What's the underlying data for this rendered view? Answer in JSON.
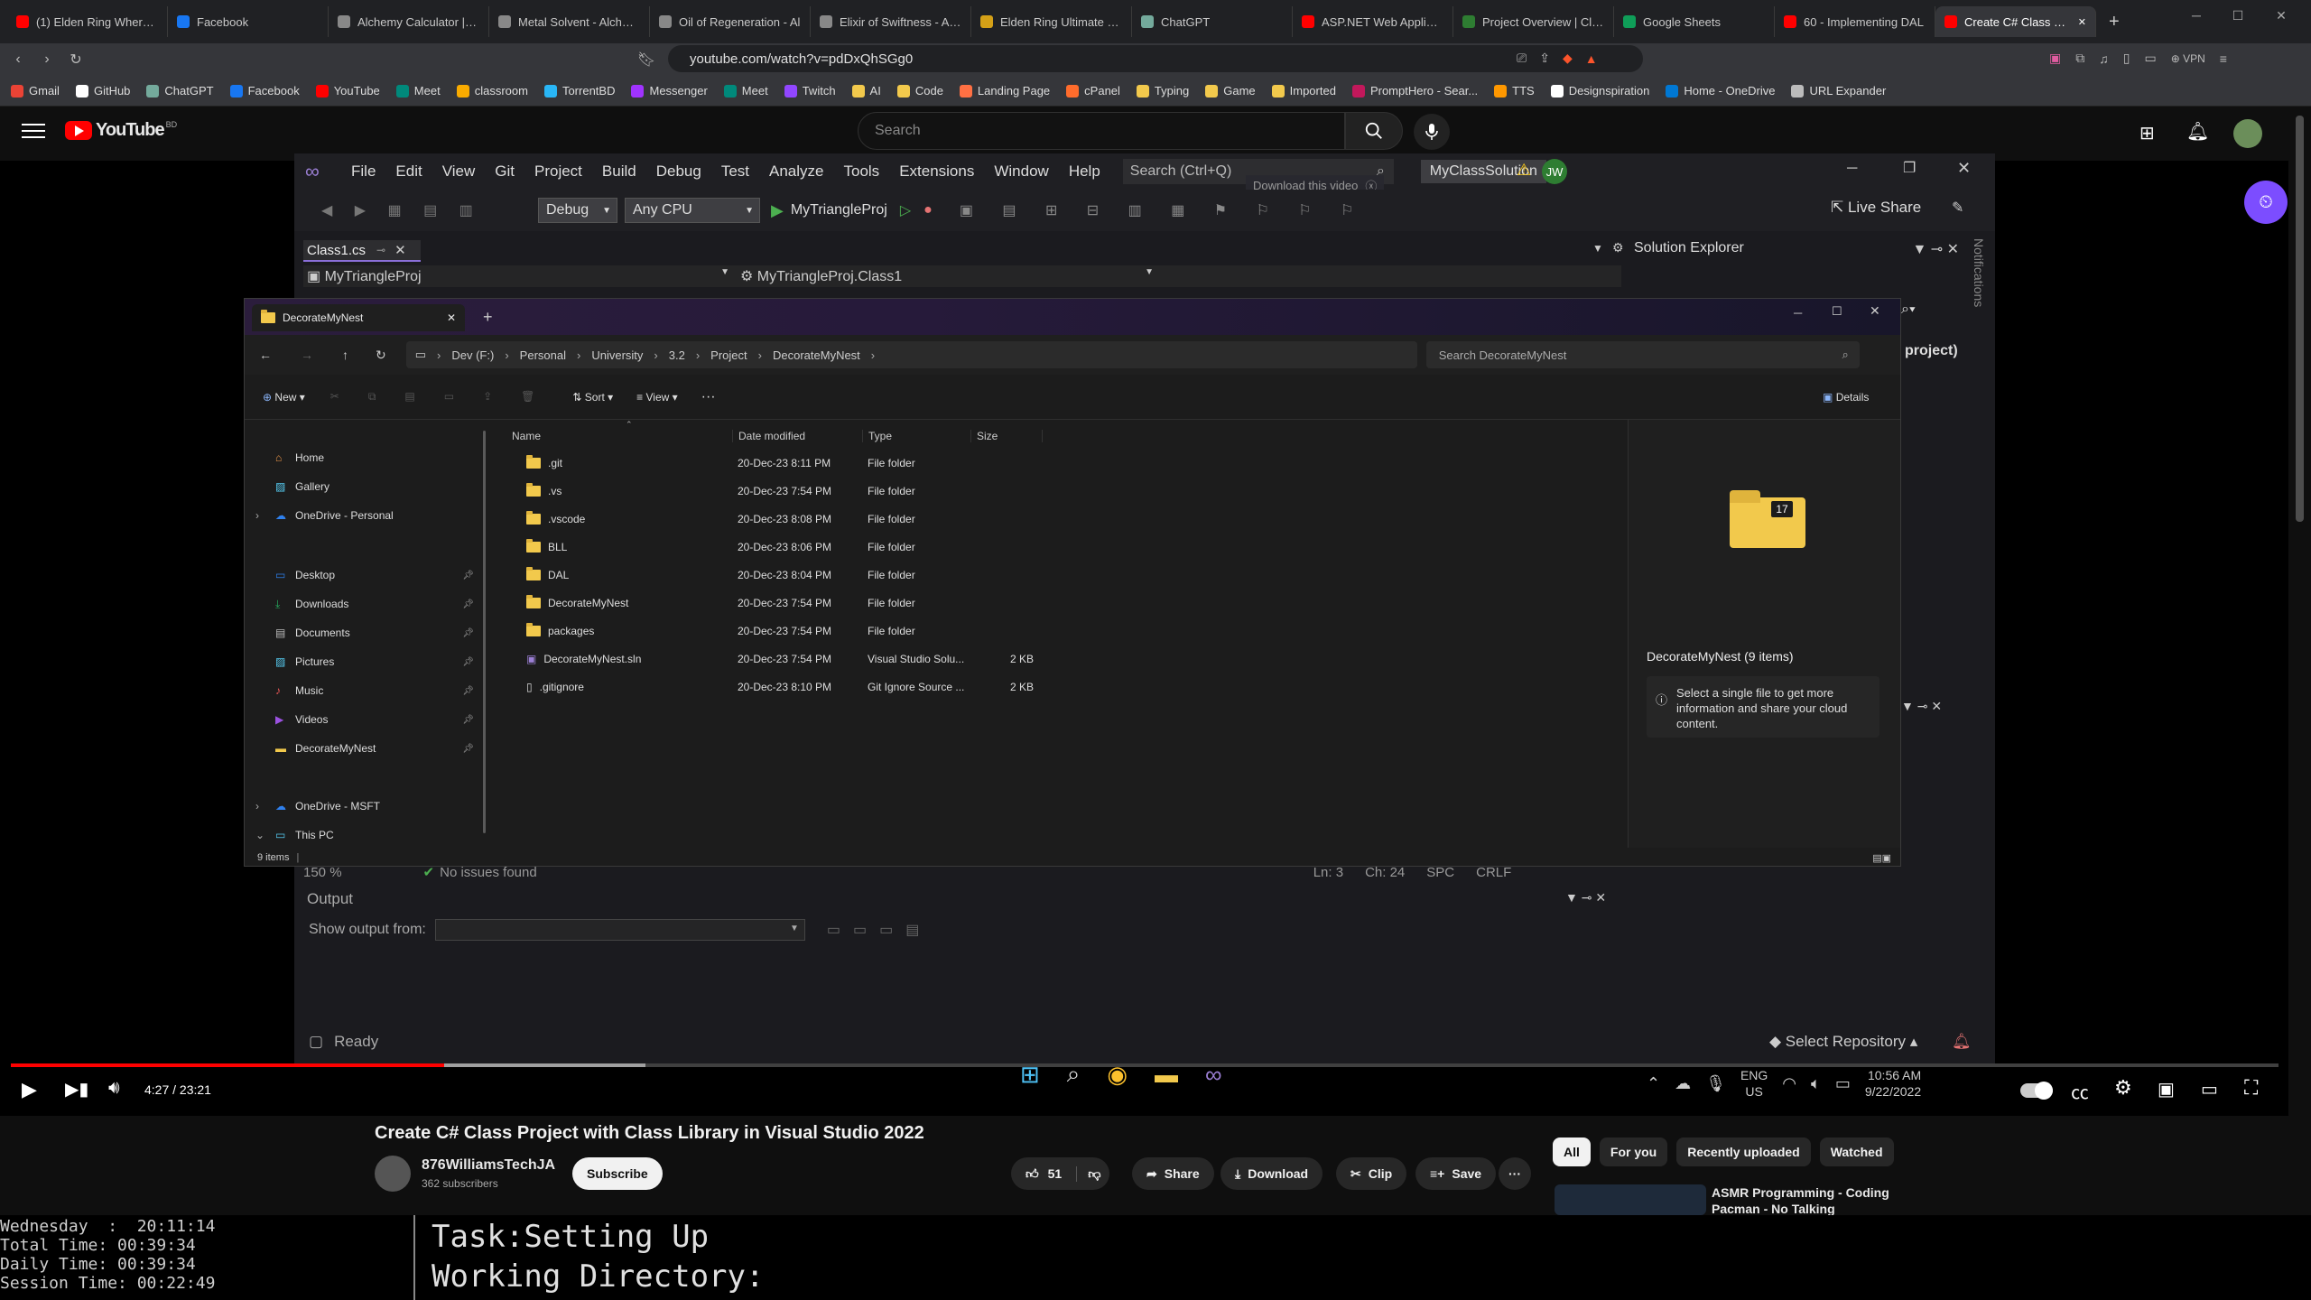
{
  "browser": {
    "tabs": [
      {
        "label": "(1) Elden Ring Where To",
        "color": "#ff0000"
      },
      {
        "label": "Facebook",
        "color": "#1877f2"
      },
      {
        "label": "Alchemy Calculator | bdc",
        "color": "#888888"
      },
      {
        "label": "Metal Solvent - Alchemy",
        "color": "#888888"
      },
      {
        "label": "Oil of Regeneration - Al",
        "color": "#888888"
      },
      {
        "label": "Elixir of Swiftness - Alche",
        "color": "#888888"
      },
      {
        "label": "Elden Ring Ultimate Che",
        "color": "#d4a017"
      },
      {
        "label": "ChatGPT",
        "color": "#74aa9c"
      },
      {
        "label": "ASP.NET Web Applicatio",
        "color": "#ff0000"
      },
      {
        "label": "Project Overview | Cloud",
        "color": "#2e7d32"
      },
      {
        "label": "Google Sheets",
        "color": "#0f9d58"
      },
      {
        "label": "60 - Implementing DAL",
        "color": "#ff0000"
      },
      {
        "label": "Create C# Class Proj",
        "color": "#ff0000"
      }
    ],
    "url": "youtube.com/watch?v=pdDxQhSGg0",
    "vpn_label": "VPN",
    "bookmarks": [
      {
        "label": "Gmail",
        "color": "#ea4335"
      },
      {
        "label": "GitHub",
        "color": "#ffffff"
      },
      {
        "label": "ChatGPT",
        "color": "#74aa9c"
      },
      {
        "label": "Facebook",
        "color": "#1877f2"
      },
      {
        "label": "YouTube",
        "color": "#ff0000"
      },
      {
        "label": "Meet",
        "color": "#00897b"
      },
      {
        "label": "classroom",
        "color": "#f9ab00"
      },
      {
        "label": "TorrentBD",
        "color": "#29b6f6"
      },
      {
        "label": "Messenger",
        "color": "#a033ff"
      },
      {
        "label": "Meet",
        "color": "#00897b"
      },
      {
        "label": "Twitch",
        "color": "#9146ff"
      },
      {
        "label": "AI",
        "color": "#f2c94c"
      },
      {
        "label": "Code",
        "color": "#f2c94c"
      },
      {
        "label": "Landing Page",
        "color": "#ff7043"
      },
      {
        "label": "cPanel",
        "color": "#ff6c2c"
      },
      {
        "label": "Typing",
        "color": "#f2c94c"
      },
      {
        "label": "Game",
        "color": "#f2c94c"
      },
      {
        "label": "Imported",
        "color": "#f2c94c"
      },
      {
        "label": "PromptHero - Sear...",
        "color": "#c2185b"
      },
      {
        "label": "TTS",
        "color": "#ff9800"
      },
      {
        "label": "Designspiration",
        "color": "#ffffff"
      },
      {
        "label": "Home - OneDrive",
        "color": "#0078d4"
      },
      {
        "label": "URL Expander",
        "color": "#bbbbbb"
      }
    ]
  },
  "youtube": {
    "logo": "YouTube",
    "region": "BD",
    "search_placeholder": "Search",
    "video_title": "Create C# Class Project with Class Library in Visual Studio 2022",
    "channel_name": "876WilliamsTechJA",
    "subscribers": "362 subscribers",
    "subscribe_label": "Subscribe",
    "likes": "51",
    "share_label": "Share",
    "download_label": "Download",
    "clip_label": "Clip",
    "save_label": "Save",
    "time_display": "4:27 / 23:21",
    "progress": 0.191,
    "buffered": 0.28,
    "filters": [
      "All",
      "For you",
      "Recently uploaded",
      "Watched"
    ],
    "rec_title_line1": "ASMR Programming - Coding",
    "rec_title_line2": "Pacman - No Talking",
    "download_video_overlay": "Download this video"
  },
  "vs": {
    "menu": [
      "File",
      "Edit",
      "View",
      "Git",
      "Project",
      "Build",
      "Debug",
      "Test",
      "Analyze",
      "Tools",
      "Extensions",
      "Window",
      "Help"
    ],
    "search": "Search (Ctrl+Q)",
    "solution": "MyClassSolution",
    "user_initials": "JW",
    "config": "Debug",
    "platform": "Any CPU",
    "startup": "MyTriangleProj",
    "live_share": "Live Share",
    "doc_tab": "Class1.cs",
    "nav_project": "MyTriangleProj",
    "nav_class": "MyTriangleProj.Class1",
    "solution_explorer": "Solution Explorer",
    "notifications": "Notifications",
    "project_text": "project)",
    "zoom": "150 %",
    "issues": "No issues found",
    "ln": "Ln: 3",
    "ch": "Ch: 24",
    "spc": "SPC",
    "crlf": "CRLF",
    "output_title": "Output",
    "show_output_from": "Show output from:",
    "status_ready": "Ready",
    "select_repo": "Select Repository"
  },
  "explorer": {
    "tab_title": "DecorateMyNest",
    "breadcrumb": [
      "Dev (F:)",
      "Personal",
      "University",
      "3.2",
      "Project",
      "DecorateMyNest"
    ],
    "search_placeholder": "Search DecorateMyNest",
    "toolbar": {
      "new": "New",
      "sort": "Sort",
      "view": "View",
      "details": "Details"
    },
    "nav": [
      {
        "label": "Home",
        "icon": "home-icon",
        "pinned": false
      },
      {
        "label": "Gallery",
        "icon": "gallery-icon",
        "pinned": false
      },
      {
        "label": "OneDrive - Personal",
        "icon": "cloud-icon",
        "pinned": false
      },
      {
        "label": "Desktop",
        "icon": "desktop-icon",
        "pinned": true
      },
      {
        "label": "Downloads",
        "icon": "download-icon",
        "pinned": true
      },
      {
        "label": "Documents",
        "icon": "document-icon",
        "pinned": true
      },
      {
        "label": "Pictures",
        "icon": "picture-icon",
        "pinned": true
      },
      {
        "label": "Music",
        "icon": "music-icon",
        "pinned": true
      },
      {
        "label": "Videos",
        "icon": "video-icon",
        "pinned": true
      },
      {
        "label": "DecorateMyNest",
        "icon": "folder-icon",
        "pinned": true
      },
      {
        "label": "OneDrive - MSFT",
        "icon": "cloud-icon",
        "pinned": false
      },
      {
        "label": "This PC",
        "icon": "pc-icon",
        "pinned": false
      }
    ],
    "columns": [
      "Name",
      "Date modified",
      "Type",
      "Size"
    ],
    "files": [
      {
        "name": ".git",
        "date": "20-Dec-23 8:11 PM",
        "type": "File folder",
        "size": "",
        "kind": "folder"
      },
      {
        "name": ".vs",
        "date": "20-Dec-23 7:54 PM",
        "type": "File folder",
        "size": "",
        "kind": "folder"
      },
      {
        "name": ".vscode",
        "date": "20-Dec-23 8:08 PM",
        "type": "File folder",
        "size": "",
        "kind": "folder"
      },
      {
        "name": "BLL",
        "date": "20-Dec-23 8:06 PM",
        "type": "File folder",
        "size": "",
        "kind": "folder"
      },
      {
        "name": "DAL",
        "date": "20-Dec-23 8:04 PM",
        "type": "File folder",
        "size": "",
        "kind": "folder"
      },
      {
        "name": "DecorateMyNest",
        "date": "20-Dec-23 7:54 PM",
        "type": "File folder",
        "size": "",
        "kind": "folder"
      },
      {
        "name": "packages",
        "date": "20-Dec-23 7:54 PM",
        "type": "File folder",
        "size": "",
        "kind": "folder"
      },
      {
        "name": "DecorateMyNest.sln",
        "date": "20-Dec-23 7:54 PM",
        "type": "Visual Studio Solu...",
        "size": "2 KB",
        "kind": "sln"
      },
      {
        "name": ".gitignore",
        "date": "20-Dec-23 8:10 PM",
        "type": "Git Ignore Source ...",
        "size": "2 KB",
        "kind": "file"
      }
    ],
    "details_title": "DecorateMyNest (9 items)",
    "details_info": "Select a single file to get more information and share your cloud content.",
    "folder_badge": "17",
    "status": "9 items"
  },
  "taskbar": {
    "lang1": "ENG",
    "lang2": "US",
    "time": "10:56 AM",
    "date": "9/22/2022"
  },
  "terminal": {
    "day_line": "Wednesday  :  20:11:14",
    "total_line": "Total Time: 00:39:34",
    "daily_line": "Daily Time: 00:39:34",
    "session_line": "Session Time: 00:22:49",
    "task_line": "Task:Setting Up",
    "dir_line": "Working Directory:"
  }
}
